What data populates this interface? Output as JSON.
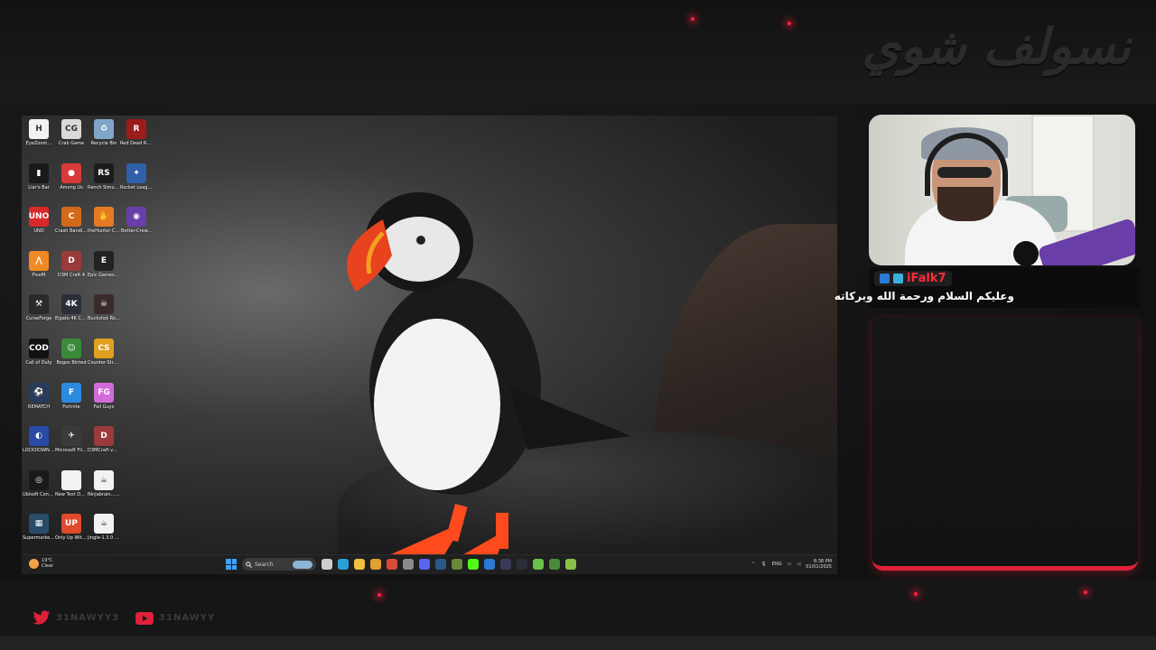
{
  "overlay": {
    "title": "نسولف شوي",
    "accent_color": "#e0203a"
  },
  "desktop": {
    "icons": [
      {
        "label": "EyeZoom...",
        "icon": "eyezoom-icon",
        "color": "#f2f2f2",
        "glyph": "H"
      },
      {
        "label": "Crab Game",
        "icon": "crab-game-icon",
        "color": "#d9d9d9",
        "glyph": "CG"
      },
      {
        "label": "Recycle Bin",
        "icon": "recycle-bin-icon",
        "color": "#7fa6c9",
        "glyph": "♻"
      },
      {
        "label": "Red Dead Redempti...",
        "icon": "red-dead-icon",
        "color": "#9c1c1c",
        "glyph": "R"
      },
      {
        "label": "Liar's Bar",
        "icon": "liars-bar-icon",
        "color": "#1a1a1a",
        "glyph": "▮"
      },
      {
        "label": "Among Us",
        "icon": "among-us-icon",
        "color": "#d83a3a",
        "glyph": "●"
      },
      {
        "label": "Ranch Simulator",
        "icon": "ranch-simulator-icon",
        "color": "#1c1c1c",
        "glyph": "RS"
      },
      {
        "label": "Rocket League®",
        "icon": "rocket-league-icon",
        "color": "#2f5fa8",
        "glyph": "✦"
      },
      {
        "label": "UNO",
        "icon": "uno-icon",
        "color": "#d8282a",
        "glyph": "UNO"
      },
      {
        "label": "Crash Bandicoot...",
        "icon": "crash-bandicoot-icon",
        "color": "#d4691a",
        "glyph": "C"
      },
      {
        "label": "theHunter Classic",
        "icon": "thehunter-icon",
        "color": "#e57a24",
        "glyph": "✋"
      },
      {
        "label": "Better-Crew...",
        "icon": "better-crew-icon",
        "color": "#6a3ea8",
        "glyph": "◉"
      },
      {
        "label": "FiveM",
        "icon": "fivem-icon",
        "color": "#f08a24",
        "glyph": "⋀"
      },
      {
        "label": "D3M Craft 4",
        "icon": "d3m-craft-icon",
        "color": "#9a3a3a",
        "glyph": "D"
      },
      {
        "label": "Epic Games Launcher",
        "icon": "epic-games-icon",
        "color": "#222222",
        "glyph": "E"
      },
      {
        "label": "",
        "icon": "",
        "color": "",
        "glyph": ""
      },
      {
        "label": "CurseForge",
        "icon": "curseforge-icon",
        "color": "#2a2a2a",
        "glyph": "⚒"
      },
      {
        "label": "Elgato 4K Captur...",
        "icon": "elgato-icon",
        "color": "#2a2f3a",
        "glyph": "4K"
      },
      {
        "label": "Buckshot Roulette",
        "icon": "buckshot-icon",
        "color": "#3a2a2a",
        "glyph": "☠"
      },
      {
        "label": "",
        "icon": "",
        "color": "",
        "glyph": ""
      },
      {
        "label": "Call of Duty",
        "icon": "call-of-duty-icon",
        "color": "#111111",
        "glyph": "COD"
      },
      {
        "label": "Bogos Binted",
        "icon": "bogos-binted-icon",
        "color": "#3a8a3a",
        "glyph": "☺"
      },
      {
        "label": "Counter-Str... 2",
        "icon": "counter-strike-icon",
        "color": "#e0a020",
        "glyph": "CS"
      },
      {
        "label": "",
        "icon": "",
        "color": "",
        "glyph": ""
      },
      {
        "label": "REMATCH",
        "icon": "rematch-icon",
        "color": "#2a3a5a",
        "glyph": "⚽"
      },
      {
        "label": "Fortnite",
        "icon": "fortnite-icon",
        "color": "#2a8ae0",
        "glyph": "F"
      },
      {
        "label": "Fall Guys",
        "icon": "fall-guys-icon",
        "color": "#d46ad8",
        "glyph": "FG"
      },
      {
        "label": "",
        "icon": "",
        "color": "",
        "glyph": ""
      },
      {
        "label": "LOCKDOWN Protocol",
        "icon": "lockdown-icon",
        "color": "#2a4aa8",
        "glyph": "◐"
      },
      {
        "label": "Microsoft Flight Si...",
        "icon": "flight-sim-icon",
        "color": "#3a3a3a",
        "glyph": "✈"
      },
      {
        "label": "D3MCraft v8.4.1 Pris...",
        "icon": "d3mcraft-icon",
        "color": "#9a3a3a",
        "glyph": "D"
      },
      {
        "label": "",
        "icon": "",
        "color": "",
        "glyph": ""
      },
      {
        "label": "Ubisoft Connect",
        "icon": "ubisoft-icon",
        "color": "#1a1a1a",
        "glyph": "◎"
      },
      {
        "label": "New Text Document",
        "icon": "text-document-icon",
        "color": "#f2f2f2",
        "glyph": ""
      },
      {
        "label": "Ninjabrain... - Shortcut",
        "icon": "java-icon",
        "color": "#f2f2f2",
        "glyph": "☕"
      },
      {
        "label": "",
        "icon": "",
        "color": "",
        "glyph": ""
      },
      {
        "label": "Supermarket Simulator",
        "icon": "supermarket-icon",
        "color": "#2a4a6a",
        "glyph": "▦"
      },
      {
        "label": "Only Up With Friends",
        "icon": "only-up-icon",
        "color": "#e04a2a",
        "glyph": "UP"
      },
      {
        "label": "Jingle-1.3.0 - Shortcut",
        "icon": "java-icon",
        "color": "#f2f2f2",
        "glyph": "☕"
      },
      {
        "label": "",
        "icon": "",
        "color": "",
        "glyph": ""
      }
    ],
    "taskbar": {
      "weather_temp": "19°C",
      "weather_desc": "Clear",
      "search_placeholder": "Search",
      "apps": [
        {
          "icon": "task-view-icon",
          "color": "#cfcfcf"
        },
        {
          "icon": "edge-icon",
          "color": "#2aa0d8"
        },
        {
          "icon": "file-explorer-icon",
          "color": "#f0c040"
        },
        {
          "icon": "chrome-icon",
          "color": "#e0a030"
        },
        {
          "icon": "chrome-alt-icon",
          "color": "#d84a3a"
        },
        {
          "icon": "mail-icon",
          "color": "#8a8a8a"
        },
        {
          "icon": "discord-icon",
          "color": "#5865f2"
        },
        {
          "icon": "steam-icon",
          "color": "#2a5a8a"
        },
        {
          "icon": "minecraft-icon",
          "color": "#6a8a3a"
        },
        {
          "icon": "kick-icon",
          "color": "#53fc18"
        },
        {
          "icon": "outlook-icon",
          "color": "#2a7ad8"
        },
        {
          "icon": "camera-app-icon",
          "color": "#3a3a5a"
        },
        {
          "icon": "elgato-4k-icon",
          "color": "#2a2f3a"
        },
        {
          "icon": "android-icon",
          "color": "#6ac04a"
        },
        {
          "icon": "launcher-icon",
          "color": "#4a8a3a"
        },
        {
          "icon": "minecraft-launcher-icon",
          "color": "#8ac04a"
        }
      ],
      "language": "ENG",
      "time": "8:38 PM",
      "date": "01/01/2025"
    }
  },
  "chat": {
    "messages": [
      {
        "username": "iFalk7",
        "text": "وعليكم السلام ورحمة الله وبركاته",
        "badge_colors": [
          "#2a7ad8",
          "#3ab0e0"
        ]
      }
    ]
  },
  "socials": [
    {
      "icon": "twitter-icon",
      "handle": "31NAWYY3",
      "color": "#e0203a"
    },
    {
      "icon": "youtube-icon",
      "handle": "31NAWYY",
      "color": "#e0203a"
    }
  ]
}
